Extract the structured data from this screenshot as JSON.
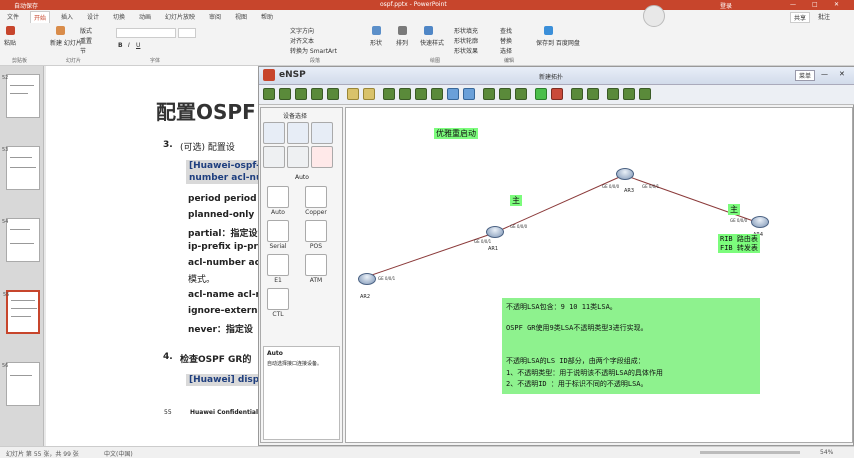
{
  "window": {
    "titlebar_left": "自动保存",
    "titlebar_center": "ospf.pptx - PowerPoint",
    "titlebar_right": "登录"
  },
  "ribbon": {
    "tabs": [
      "文件",
      "开始",
      "插入",
      "设计",
      "切换",
      "动画",
      "幻灯片放映",
      "审阅",
      "视图",
      "帮助"
    ],
    "active_tab_index": 1,
    "groups": [
      "剪贴板",
      "幻灯片",
      "字体",
      "段落",
      "绘图",
      "编辑"
    ],
    "buttons": {
      "paste": "粘贴",
      "new_slide": "新建\n幻灯片",
      "layout": "版式",
      "reset": "重置",
      "section": "节",
      "text_direction": "文字方向",
      "align_text": "对齐文本",
      "smartart": "转换为 SmartArt",
      "shapes": "形状",
      "arrange": "排列",
      "quick_styles": "快速样式",
      "shape_fill": "形状填充",
      "shape_outline": "形状轮廓",
      "shape_effects": "形状效果",
      "find": "查找",
      "replace": "替换",
      "select": "选择",
      "save_to_cloud": "保存到\n百度网盘"
    },
    "share_button": "共享",
    "comments_button": "批注"
  },
  "slide_panel": {
    "numbers": [
      "52",
      "53",
      "54",
      "55",
      "56"
    ],
    "active_index": 3
  },
  "slide": {
    "title": "配置OSPF G",
    "step3_num": "3.",
    "step3_text": "(可选) 配置设",
    "box1_line1": "[Huawei-ospf-1",
    "box1_line2": "number acl-nu",
    "params": [
      "period period",
      "planned-only",
      "partial：指定设",
      "ip-prefix ip-pre",
      "acl-number acl",
      "模式。",
      "acl-name acl-n",
      "ignore-externa",
      "never：指定设"
    ],
    "step4_num": "4.",
    "step4_text": "检查OSPF GR的",
    "box2": "[Huawei] displa",
    "footer_page": "55",
    "footer_text": "Huawei Confidential"
  },
  "ensp": {
    "title": "eNSP",
    "window_title": "新建拓扑",
    "menu_label": "菜单",
    "device_panel_title": "设备选择",
    "device_category": "Auto",
    "devices": [
      "Auto",
      "Copper",
      "Serial",
      "POS",
      "E1",
      "ATM",
      "CTL"
    ],
    "desc_title": "Auto",
    "desc_text": "自动选择接口连接设备。",
    "routers": [
      {
        "name": "AR2"
      },
      {
        "name": "AR1"
      },
      {
        "name": "AR3"
      },
      {
        "name": "AR4"
      }
    ],
    "ports": [
      "GE 0/0/1",
      "GE 0/0/1",
      "GE 0/0/0",
      "GE 0/0/0",
      "GE 0/0/1",
      "GE 0/0/0",
      "GE 0/0/1"
    ],
    "labels": {
      "graceful": "优雅重启动",
      "master1": "主",
      "master2": "主",
      "rib": "RIB  路由表",
      "fib": "FIB  转发表"
    },
    "note": {
      "line1": "不透明LSA包含：9 10 11类LSA。",
      "line2": "OSPF GR使用9类LSA不透明类型3进行实现。",
      "line3": "不透明LSA的LS ID部分，由两个字段组成：",
      "line4": "  1、不透明类型：用于说明该不透明LSA的具体作用",
      "line5": "  2、不透明ID ：用于标识不同的不透明LSA。"
    },
    "colors": {
      "note_bg": "#8ef28e",
      "link": "#8b3a3a"
    }
  },
  "statusbar": {
    "left": "幻灯片 第 55 张，共 99 张",
    "lang": "中文(中国)",
    "zoom": "54%"
  }
}
